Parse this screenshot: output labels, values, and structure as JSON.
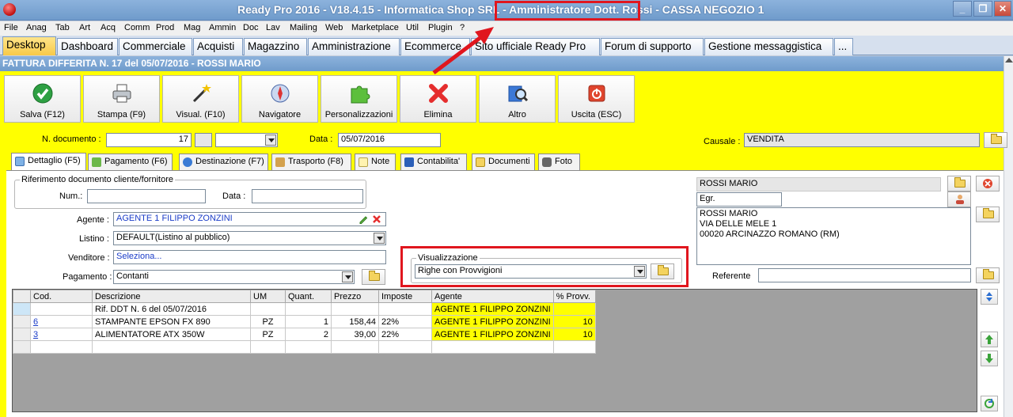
{
  "window": {
    "title": "Ready Pro 2016 - V18.4.15 - Informatica Shop SRL - Amministratore Dott. Rossi - CASSA NEGOZIO 1",
    "minimize": "_",
    "restore": "❐",
    "close": "✕"
  },
  "menu": [
    "File",
    "Anag",
    "Tab",
    "Art",
    "Acq",
    "Comm",
    "Prod",
    "Mag",
    "Ammin",
    "Doc",
    "Lav",
    "Mailing",
    "Web",
    "Marketplace",
    "Util",
    "Plugin",
    "?"
  ],
  "tabs": [
    "Desktop",
    "Dashboard",
    "Commerciale",
    "Acquisti",
    "Magazzino",
    "Amministrazione",
    "Ecommerce",
    "Sito ufficiale Ready Pro",
    "Forum di supporto",
    "Gestione messaggistica",
    "..."
  ],
  "form_title": "FATTURA DIFFERITA N. 17 del 05/07/2016 - ROSSI MARIO",
  "toolbar": [
    {
      "label": "Salva (F12)",
      "icon": "check-icon"
    },
    {
      "label": "Stampa (F9)",
      "icon": "printer-icon"
    },
    {
      "label": "Visual. (F10)",
      "icon": "magic-wand-icon"
    },
    {
      "label": "Navigatore",
      "icon": "compass-icon"
    },
    {
      "label": "Personalizzazioni",
      "icon": "puzzle-icon"
    },
    {
      "label": "Elimina",
      "icon": "delete-x-icon"
    },
    {
      "label": "Altro",
      "icon": "book-search-icon"
    },
    {
      "label": "Uscita (ESC)",
      "icon": "power-icon"
    }
  ],
  "header": {
    "ndoc_label": "N. documento :",
    "ndoc_value": "17",
    "data_label": "Data :",
    "data_value": "05/07/2016",
    "causale_label": "Causale :",
    "causale_value": "VENDITA"
  },
  "subtabs": [
    "Dettaglio (F5)",
    "Pagamento (F6)",
    "Destinazione (F7)",
    "Trasporto (F8)",
    "Note",
    "Contabilita'",
    "Documenti",
    "Foto"
  ],
  "riferimento": {
    "title": "Riferimento documento cliente/fornitore",
    "num_label": "Num.:",
    "num_value": "",
    "data_label": "Data :",
    "data_value": ""
  },
  "agente": {
    "label": "Agente :",
    "value": "AGENTE 1 FILIPPO ZONZINI"
  },
  "listino": {
    "label": "Listino :",
    "value": "DEFAULT(Listino al pubblico)"
  },
  "venditore": {
    "label": "Venditore :",
    "value": "Seleziona..."
  },
  "pagamento": {
    "label": "Pagamento :",
    "value": "Contanti"
  },
  "visualizzazione": {
    "title": "Visualizzazione",
    "value": "Righe con Provvigioni"
  },
  "cliente": {
    "name": "ROSSI MARIO",
    "title_value": "Egr.",
    "address": [
      "ROSSI MARIO",
      "VIA DELLE MELE 1",
      "00020 ARCINAZZO ROMANO (RM)"
    ],
    "referente_label": "Referente",
    "referente_value": ""
  },
  "grid": {
    "columns": [
      "Cod.",
      "Descrizione",
      "UM",
      "Quant.",
      "Prezzo",
      "Imposte",
      "Agente",
      "% Provv."
    ],
    "rows": [
      {
        "cod": "",
        "descr": "Rif. DDT N. 6 del 05/07/2016",
        "um": "",
        "qty": "",
        "prezzo": "",
        "imposte": "",
        "agente": "AGENTE 1 FILIPPO ZONZINI",
        "provv": ""
      },
      {
        "cod": "6",
        "descr": "STAMPANTE EPSON FX 890",
        "um": "PZ",
        "qty": "1",
        "prezzo": "158,44",
        "imposte": "22%",
        "agente": "AGENTE 1 FILIPPO ZONZINI",
        "provv": "10"
      },
      {
        "cod": "3",
        "descr": "ALIMENTATORE ATX 350W",
        "um": "PZ",
        "qty": "2",
        "prezzo": "39,00",
        "imposte": "22%",
        "agente": "AGENTE 1 FILIPPO ZONZINI",
        "provv": "10"
      },
      {
        "cod": "",
        "descr": "",
        "um": "",
        "qty": "",
        "prezzo": "",
        "imposte": "",
        "agente": "",
        "provv": ""
      }
    ]
  },
  "colors": {
    "form_bg": "#ffff00",
    "annotation": "#e0161e",
    "title_bar": "#7aa3d2"
  }
}
